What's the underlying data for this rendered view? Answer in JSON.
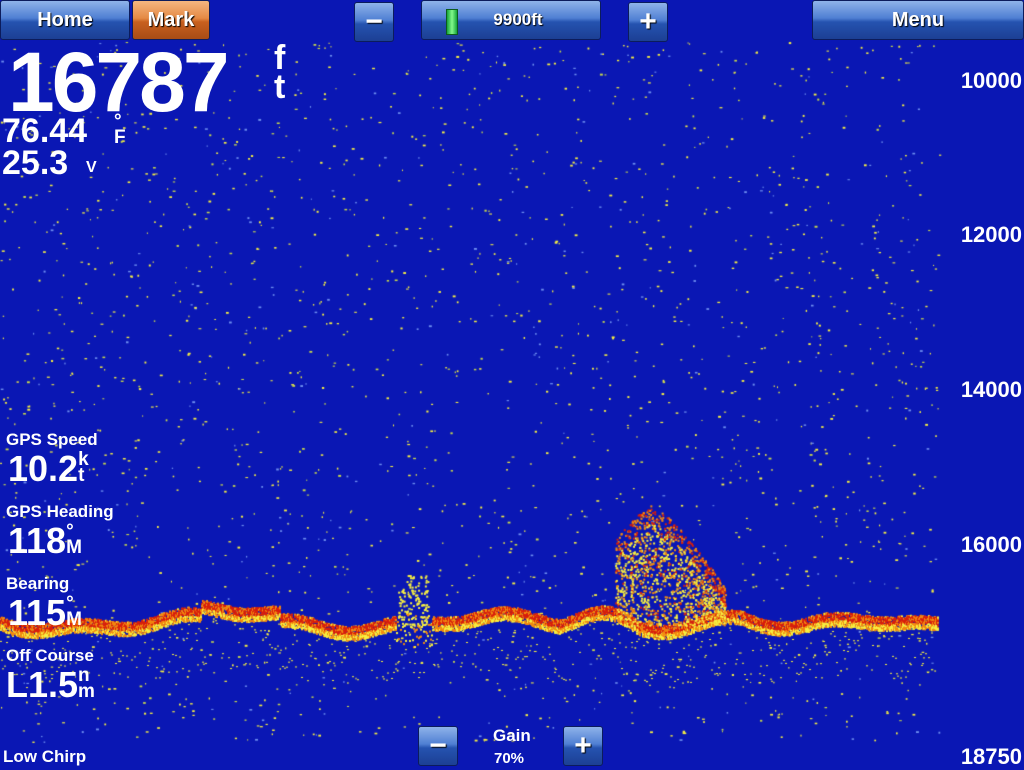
{
  "toolbar": {
    "home_label": "Home",
    "mark_label": "Mark",
    "range_minus": "−",
    "range_value": "9900ft",
    "range_plus": "+",
    "menu_label": "Menu"
  },
  "readouts": {
    "depth": {
      "value": "16787",
      "unit_top": "f",
      "unit_bottom": "t"
    },
    "water_temp": {
      "value": "76.44",
      "degree": "°",
      "unit": "F"
    },
    "voltage": {
      "value": "25.3",
      "unit": "V"
    }
  },
  "data_fields": [
    {
      "label": "GPS Speed",
      "value": "10.2",
      "unit_top": "k",
      "unit_bottom": "t"
    },
    {
      "label": "GPS Heading",
      "value": "118",
      "unit_top": "°",
      "unit_bottom": "M"
    },
    {
      "label": "Bearing",
      "value": "115",
      "unit_top": "°",
      "unit_bottom": "M"
    },
    {
      "label": "Off Course",
      "value": "L1.5",
      "unit_top": "n",
      "unit_bottom": "m"
    }
  ],
  "depth_scale": [
    "10000",
    "12000",
    "14000",
    "16000",
    "18750"
  ],
  "gain": {
    "label": "Gain",
    "value": "70%",
    "minus": "−",
    "plus": "+"
  },
  "mode": "Low Chirp",
  "colors": {
    "water": "#0a17b4",
    "return_strong": "#d81e0c",
    "return_mid": "#f28a10",
    "return_weak": "#f8f040",
    "button_blue": "#2553b0",
    "button_orange": "#c8601f"
  }
}
